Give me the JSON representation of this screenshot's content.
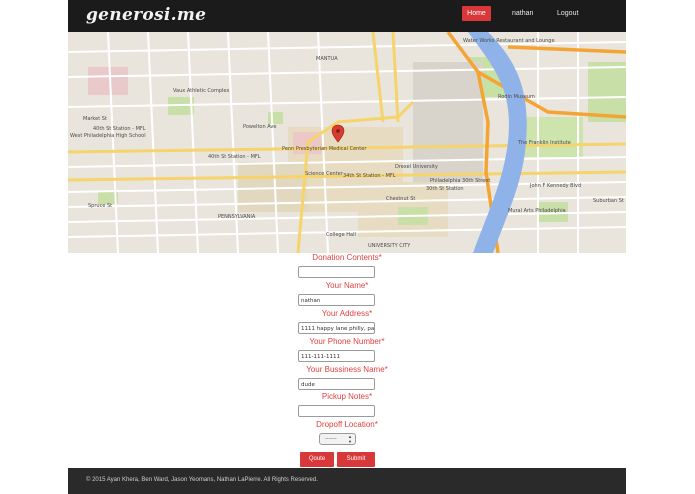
{
  "nav": {
    "brand": "generosi.me",
    "home": "Home",
    "user": "nathan",
    "logout": "Logout"
  },
  "map": {
    "labels": {
      "vaux": "Vaux Athletic Complex",
      "market_st": "Market St",
      "powelton": "Powelton Ave",
      "west_phila": "West Philadelphia High School",
      "station_40th": "40th St Station - MFL",
      "station_34th": "34th St Station - MFL",
      "penn_presb": "Penn Presbyterian Medical Center",
      "science_center": "Science Center",
      "drexel": "Drexel University",
      "walnut_st": "Walnut St",
      "chestnut_st": "Chestnut St",
      "spruce_st": "Spruce St",
      "college_hall": "College Hall",
      "mantua": "MANTUA",
      "phila_30th": "Philadelphia 30th Street",
      "station_30th": "30th St Station",
      "mural": "Mural Arts Philadelphia",
      "waterworks": "Water Works Restaurant and Lounge",
      "rodin": "Rodin Museum",
      "franklin": "The Franklin Institute",
      "kennedy": "John F Kennedy Blvd",
      "suburban": "Suburban St",
      "pennsylvania": "PENNSYLVANIA",
      "university_city": "UNIVERSITY CITY"
    }
  },
  "form": {
    "donation_label": "Donation Contents*",
    "donation_value": "",
    "name_label": "Your Name*",
    "name_value": "nathan",
    "address_label": "Your Address*",
    "address_value": "1111 happy lane philly, pa",
    "phone_label": "Your Phone Number*",
    "phone_value": "111-111-1111",
    "business_label": "Your Bussiness Name*",
    "business_value": "dude",
    "notes_label": "Pickup Notes*",
    "notes_value": "",
    "dropoff_label": "Dropoff Location*",
    "dropoff_value": "-------",
    "quote_button": "Qoute",
    "submit_button": "Submit"
  },
  "footer": {
    "text": "© 2015 Ayan Khera, Ben Ward, Jason Yeomans, Nathan LaPierre. All Rights Reserved."
  },
  "colors": {
    "accent": "#d9383a",
    "navbar": "#1b1b1b",
    "label": "#e04040"
  }
}
